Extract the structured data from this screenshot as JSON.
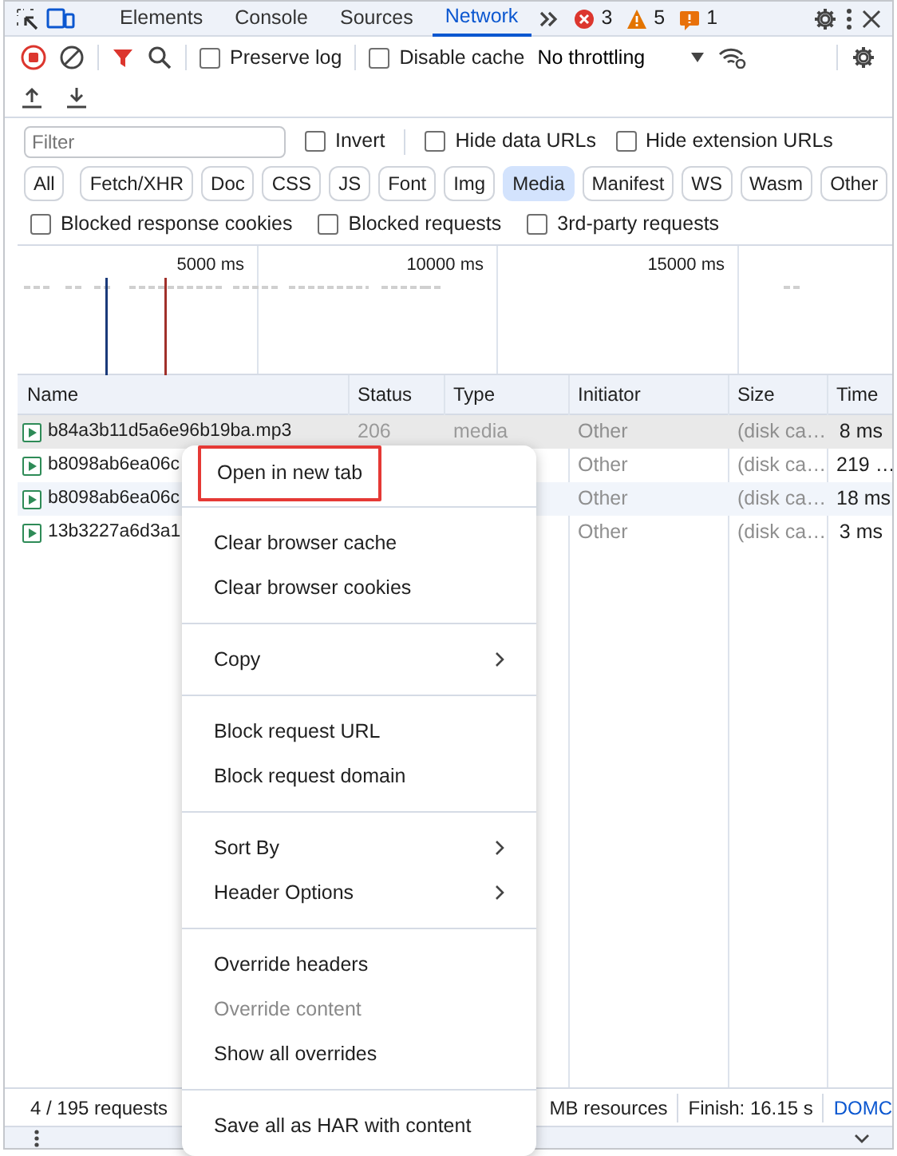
{
  "tabs": [
    {
      "label": "Elements",
      "selected": false
    },
    {
      "label": "Console",
      "selected": false
    },
    {
      "label": "Sources",
      "selected": false
    },
    {
      "label": "Network",
      "selected": true
    }
  ],
  "issues": [
    {
      "kind": "error",
      "count": "3"
    },
    {
      "kind": "warning",
      "count": "5"
    },
    {
      "kind": "info",
      "count": "1"
    }
  ],
  "toolbar": {
    "options": [
      {
        "label": "Preserve log",
        "checked": false
      },
      {
        "label": "Disable cache",
        "checked": false
      }
    ],
    "throttling": "No throttling"
  },
  "filter": {
    "placeholder": "Filter",
    "options": [
      {
        "label": "Invert",
        "checked": false
      },
      {
        "label": "Hide data URLs",
        "checked": false
      },
      {
        "label": "Hide extension URLs",
        "checked": false
      }
    ]
  },
  "type_filters": [
    {
      "label": "All",
      "selected": false
    },
    {
      "label": "Fetch/XHR",
      "selected": false
    },
    {
      "label": "Doc",
      "selected": false
    },
    {
      "label": "CSS",
      "selected": false
    },
    {
      "label": "JS",
      "selected": false
    },
    {
      "label": "Font",
      "selected": false
    },
    {
      "label": "Img",
      "selected": false
    },
    {
      "label": "Media",
      "selected": true
    },
    {
      "label": "Manifest",
      "selected": false
    },
    {
      "label": "WS",
      "selected": false
    },
    {
      "label": "Wasm",
      "selected": false
    },
    {
      "label": "Other",
      "selected": false
    }
  ],
  "blocked_options": [
    {
      "label": "Blocked response cookies",
      "checked": false
    },
    {
      "label": "Blocked requests",
      "checked": false
    },
    {
      "label": "3rd-party requests",
      "checked": false
    }
  ],
  "overview": {
    "ticks": [
      "5000 ms",
      "10000 ms",
      "15000 ms"
    ]
  },
  "table": {
    "columns": [
      "Name",
      "Status",
      "Type",
      "Initiator",
      "Size",
      "Time"
    ],
    "rows": [
      {
        "name": "b84a3b11d5a6e96b19ba.mp3",
        "status": "206",
        "type": "media",
        "initiator": "Other",
        "size": "(disk ca…",
        "time": "8 ms",
        "selected": true
      },
      {
        "name": "b8098ab6ea06c",
        "initiator": "Other",
        "size": "(disk ca…",
        "time": "219 …",
        "selected": false
      },
      {
        "name": "b8098ab6ea06c",
        "initiator": "Other",
        "size": "(disk ca…",
        "time": "18 ms",
        "selected": false
      },
      {
        "name": "13b3227a6d3a1",
        "initiator": "Other",
        "size": "(disk ca…",
        "time": "3 ms",
        "selected": false
      }
    ]
  },
  "status_bar": [
    {
      "kind": "text",
      "text": "4 / 195 requests"
    },
    {
      "kind": "text",
      "text": "MB resources"
    },
    {
      "kind": "text",
      "text": "Finish: 16.15 s"
    },
    {
      "kind": "link",
      "text": "DOMC"
    }
  ],
  "context_menu": {
    "sections": [
      [
        {
          "label": "Open in new tab",
          "highlighted": true,
          "has_submenu": false,
          "disabled": false
        }
      ],
      [
        {
          "label": "Clear browser cache",
          "highlighted": false,
          "has_submenu": false,
          "disabled": false
        },
        {
          "label": "Clear browser cookies",
          "highlighted": false,
          "has_submenu": false,
          "disabled": false
        }
      ],
      [
        {
          "label": "Copy",
          "highlighted": false,
          "has_submenu": true,
          "disabled": false
        }
      ],
      [
        {
          "label": "Block request URL",
          "highlighted": false,
          "has_submenu": false,
          "disabled": false
        },
        {
          "label": "Block request domain",
          "highlighted": false,
          "has_submenu": false,
          "disabled": false
        }
      ],
      [
        {
          "label": "Sort By",
          "highlighted": false,
          "has_submenu": true,
          "disabled": false
        },
        {
          "label": "Header Options",
          "highlighted": false,
          "has_submenu": true,
          "disabled": false
        }
      ],
      [
        {
          "label": "Override headers",
          "highlighted": false,
          "has_submenu": false,
          "disabled": false
        },
        {
          "label": "Override content",
          "highlighted": false,
          "has_submenu": false,
          "disabled": true
        },
        {
          "label": "Show all overrides",
          "highlighted": false,
          "has_submenu": false,
          "disabled": false
        }
      ],
      [
        {
          "label": "Save all as HAR with content",
          "highlighted": false,
          "has_submenu": false,
          "disabled": false
        }
      ]
    ]
  }
}
